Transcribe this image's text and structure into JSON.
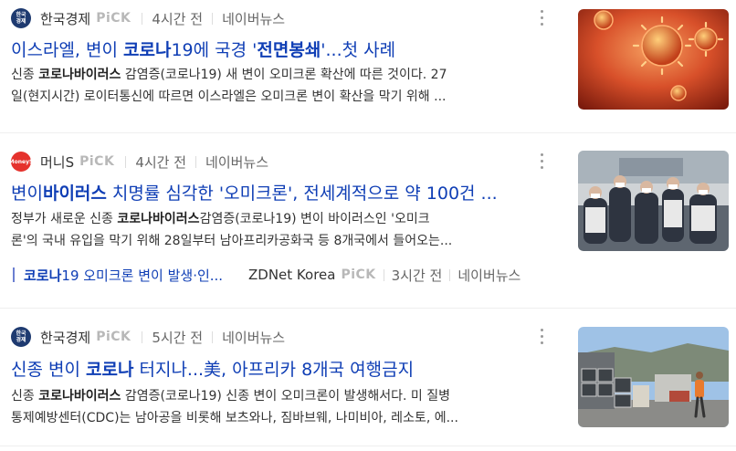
{
  "articles": [
    {
      "press": "한국경제",
      "pick": "PiCK",
      "time": "4시간 전",
      "naver": "네이버뉴스",
      "logo_text": "한국\n경제",
      "title": [
        {
          "t": "이스라엘, 변이 ",
          "b": false
        },
        {
          "t": "코로나",
          "b": true
        },
        {
          "t": "19에 국경 '",
          "b": false
        },
        {
          "t": "전면봉쇄",
          "b": true
        },
        {
          "t": "'...첫 사례",
          "b": false
        }
      ],
      "desc": [
        [
          {
            "t": "신종 ",
            "b": false
          },
          {
            "t": "코로나바이러스",
            "b": true
          },
          {
            "t": " 감염증(코로나19) 새 변이 오미크론 확산에 따른 것이다. 27",
            "b": false
          }
        ],
        [
          {
            "t": "일(현지시간) 로이터통신에 따르면 이스라엘은 오미크론 변이 확산을 막기 위해 ...",
            "b": false
          }
        ]
      ]
    },
    {
      "press": "머니S",
      "pick": "PiCK",
      "time": "4시간 전",
      "naver": "네이버뉴스",
      "logo_text": "MoneyS",
      "title": [
        {
          "t": "변이",
          "b": false
        },
        {
          "t": "바이러스",
          "b": true
        },
        {
          "t": " 치명률 심각한 '오미크론', 전세계적으로 약 100건 ...",
          "b": false
        }
      ],
      "desc": [
        [
          {
            "t": "정부가 새로운 신종 ",
            "b": false
          },
          {
            "t": "코로나바이러스",
            "b": true
          },
          {
            "t": "감염증(코로나19) 변이 바이러스인 '오미크",
            "b": false
          }
        ],
        [
          {
            "t": "론'의 국내 유입을 막기 위해 28일부터 남아프리카공화국 등 8개국에서 들어오는...",
            "b": false
          }
        ]
      ],
      "related": {
        "title": [
          {
            "t": "코로나",
            "b": true
          },
          {
            "t": "19 오미크론 변이 발생·인...",
            "b": false
          }
        ],
        "press": "ZDNet Korea",
        "pick": "PiCK",
        "time": "3시간 전",
        "naver": "네이버뉴스"
      }
    },
    {
      "press": "한국경제",
      "pick": "PiCK",
      "time": "5시간 전",
      "naver": "네이버뉴스",
      "logo_text": "한국\n경제",
      "title": [
        {
          "t": "신종 변이 ",
          "b": false
        },
        {
          "t": "코로나",
          "b": true
        },
        {
          "t": " 터지나...美, 아프리카 8개국 여행금지",
          "b": false
        }
      ],
      "desc": [
        [
          {
            "t": "신종 ",
            "b": false
          },
          {
            "t": "코로나바이러스",
            "b": true
          },
          {
            "t": " 감염증(코로나19) 신종 변이 오미크론이 발생해서다. 미 질병",
            "b": false
          }
        ],
        [
          {
            "t": "통제예방센터(CDC)는 남아공을 비롯해 보츠와나, 짐바브웨, 나미비아, 레소토, 에...",
            "b": false
          }
        ]
      ]
    }
  ]
}
